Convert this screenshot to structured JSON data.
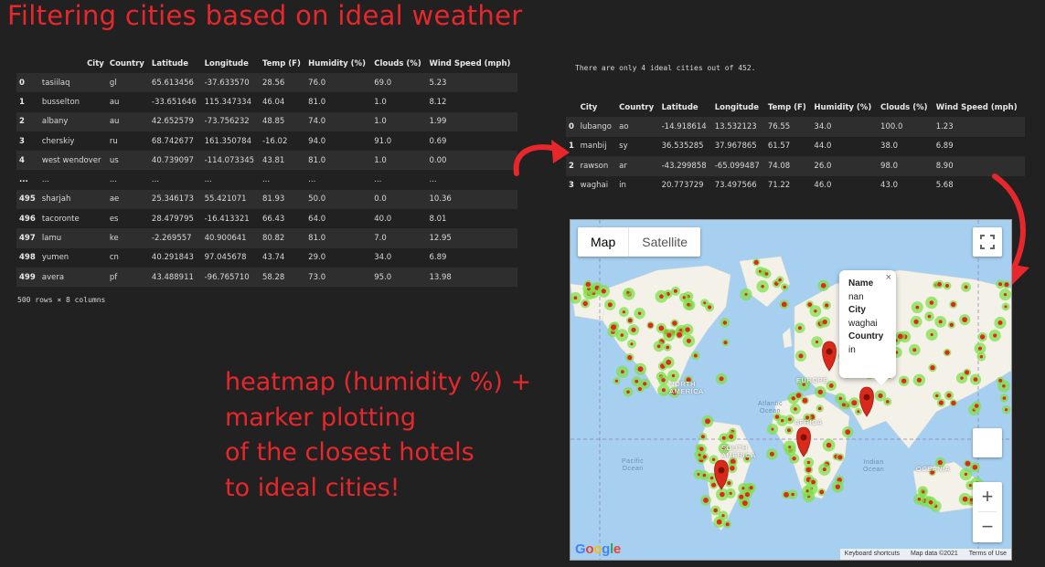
{
  "title": "Filtering cities based on ideal weather",
  "table1": {
    "columns": [
      "",
      "City",
      "Country",
      "Latitude",
      "Longitude",
      "Temp (F)",
      "Humidity (%)",
      "Clouds (%)",
      "Wind Speed (mph)"
    ],
    "rows": [
      [
        "0",
        "tasiilaq",
        "gl",
        "65.613456",
        "-37.633570",
        "28.56",
        "76.0",
        "69.0",
        "5.23"
      ],
      [
        "1",
        "busselton",
        "au",
        "-33.651646",
        "115.347334",
        "46.04",
        "81.0",
        "1.0",
        "8.12"
      ],
      [
        "2",
        "albany",
        "au",
        "42.652579",
        "-73.756232",
        "48.85",
        "74.0",
        "1.0",
        "1.99"
      ],
      [
        "3",
        "cherskiy",
        "ru",
        "68.742677",
        "161.350784",
        "-16.02",
        "94.0",
        "91.0",
        "0.69"
      ],
      [
        "4",
        "west wendover",
        "us",
        "40.739097",
        "-114.073345",
        "43.81",
        "81.0",
        "1.0",
        "0.00"
      ],
      [
        "...",
        "...",
        "...",
        "...",
        "...",
        "...",
        "...",
        "...",
        "..."
      ],
      [
        "495",
        "sharjah",
        "ae",
        "25.346173",
        "55.421071",
        "81.93",
        "50.0",
        "0.0",
        "10.36"
      ],
      [
        "496",
        "tacoronte",
        "es",
        "28.479795",
        "-16.413321",
        "66.43",
        "64.0",
        "40.0",
        "8.01"
      ],
      [
        "497",
        "lamu",
        "ke",
        "-2.269557",
        "40.900641",
        "80.82",
        "81.0",
        "7.0",
        "12.95"
      ],
      [
        "498",
        "yumen",
        "cn",
        "40.291843",
        "97.045678",
        "43.74",
        "29.0",
        "34.0",
        "6.89"
      ],
      [
        "499",
        "avera",
        "pf",
        "43.488911",
        "-96.765710",
        "58.28",
        "73.0",
        "95.0",
        "13.98"
      ]
    ],
    "footer": "500 rows × 8 columns"
  },
  "ideal_message": "There are only 4 ideal cities out of 452.",
  "table2": {
    "columns": [
      "",
      "City",
      "Country",
      "Latitude",
      "Longitude",
      "Temp (F)",
      "Humidity (%)",
      "Clouds (%)",
      "Wind Speed (mph)"
    ],
    "rows": [
      [
        "0",
        "lubango",
        "ao",
        "-14.918614",
        "13.532123",
        "76.55",
        "34.0",
        "100.0",
        "1.23"
      ],
      [
        "1",
        "manbij",
        "sy",
        "36.535285",
        "37.967865",
        "61.57",
        "44.0",
        "38.0",
        "6.89"
      ],
      [
        "2",
        "rawson",
        "ar",
        "-43.299858",
        "-65.099487",
        "74.08",
        "26.0",
        "98.0",
        "8.90"
      ],
      [
        "3",
        "waghai",
        "in",
        "20.773729",
        "73.497566",
        "71.22",
        "46.0",
        "43.0",
        "5.68"
      ]
    ]
  },
  "annotation": [
    "heatmap (humidity %) +",
    "marker plotting",
    "of the closest hotels",
    "to ideal cities!"
  ],
  "map": {
    "map_tab": "Map",
    "satellite_tab": "Satellite",
    "fullscreen_icon": "fullscreen-icon",
    "zoom_in": "+",
    "zoom_out": "−",
    "popup": {
      "name_label": "Name",
      "name_value": "nan",
      "city_label": "City",
      "city_value": "waghai",
      "country_label": "Country",
      "country_value": "in",
      "close": "×"
    },
    "labels": {
      "north_america": "NORTH\nAMERICA",
      "south_america": "SOUTH\nAMERICA",
      "europe": "EUROPE",
      "africa": "AFRICA",
      "oceania": "OCEANIA",
      "atlantic": "Atlantic\nOcean",
      "pacific": "Pacific\nOcean",
      "indian": "Indian\nOcean"
    },
    "google_logo": "Google",
    "attribution": [
      "Keyboard shortcuts",
      "Map data ©2021",
      "Terms of Use"
    ],
    "colors": {
      "ocean": "#a6cff0",
      "land": "#f4f1e8",
      "heat_low": "#7fe04a",
      "heat_high": "#e0281e",
      "marker": "#d9291b"
    }
  }
}
